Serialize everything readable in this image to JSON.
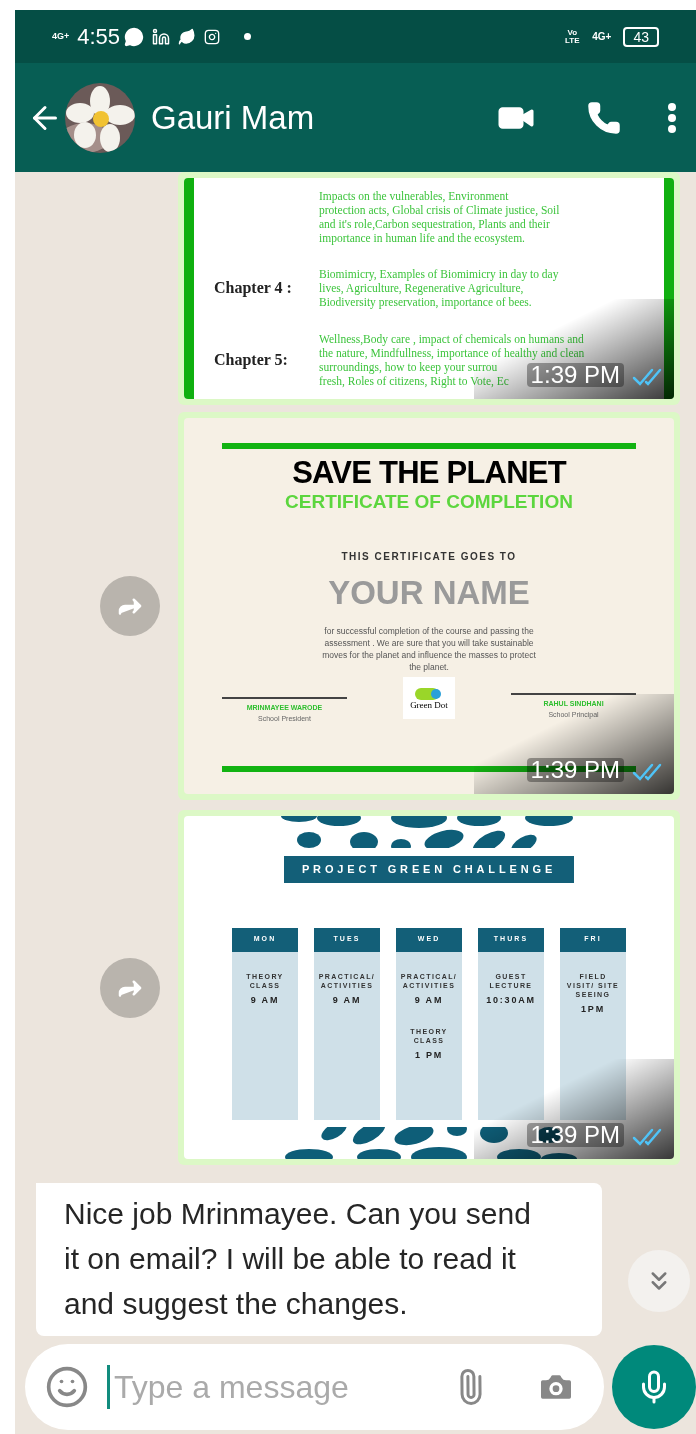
{
  "status_bar": {
    "network": "4G+",
    "time": "4:55",
    "volte": "Vo LTE",
    "network_right": "4G+",
    "battery": "43"
  },
  "header": {
    "contact_name": "Gauri Mam"
  },
  "messages": [
    {
      "kind": "syllabus",
      "forward_button": false,
      "time": "1:39 PM",
      "read": true,
      "rows": [
        {
          "lines": [
            "Impacts on the vulnerables, Environment",
            "protection acts, Global crisis of Climate justice, Soil",
            "and it's role,Carbon sequestration, Plants and their",
            "importance in human life and the ecosystem."
          ]
        },
        {
          "label": "Chapter 4 :",
          "lines": [
            "Biomimicry, Examples of Biomimicry in day to day",
            "lives, Agriculture, Regenerative Agriculture,",
            "Biodiversity preservation, importance of bees."
          ]
        },
        {
          "label": "Chapter 5:",
          "lines": [
            "Wellness,Body care , impact of chemicals on humans and",
            "the nature,  Mindfullness, importance of healthy and clean",
            "surroundings, how to keep your surrou",
            "fresh, Roles of citizens, Right to Vote, Ec"
          ]
        }
      ]
    },
    {
      "kind": "certificate",
      "forward_button": true,
      "time": "1:39 PM",
      "read": true,
      "title": "SAVE THE PLANET",
      "subtitle": "CERTIFICATE OF COMPLETION",
      "intro": "THIS CERTIFICATE GOES TO",
      "name": "YOUR NAME",
      "body": "for successful completion of the course and passing the assessment . We are sure that you will take sustainable moves for the planet and influence the masses to protect the planet.",
      "logo": "Green Dot",
      "signatories": [
        {
          "name": "MRINMAYEE WARODE",
          "role": "School President"
        },
        {
          "name": "RAHUL SINDHANI",
          "role": "School Principal"
        }
      ]
    },
    {
      "kind": "schedule",
      "forward_button": true,
      "time": "1:39 PM",
      "read": true,
      "title": "PROJECT GREEN CHALLENGE",
      "days": [
        {
          "day": "MON",
          "entries": [
            {
              "activity": "THEORY CLASS",
              "time": "9 AM"
            }
          ]
        },
        {
          "day": "TUES",
          "entries": [
            {
              "activity": "PRACTICAL/ ACTIVITIES",
              "time": "9 AM"
            }
          ]
        },
        {
          "day": "WED",
          "entries": [
            {
              "activity": "PRACTICAL/ ACTIVITIES",
              "time": "9 AM"
            },
            {
              "activity": "THEORY CLASS",
              "time": "1 PM"
            }
          ]
        },
        {
          "day": "THURS",
          "entries": [
            {
              "activity": "GUEST LECTURE",
              "time": "10:30AM"
            }
          ]
        },
        {
          "day": "FRI",
          "entries": [
            {
              "activity": "FIELD VISIT/ SITE SEEING",
              "time": "1PM"
            }
          ]
        }
      ]
    },
    {
      "kind": "text",
      "text": "Nice job Mrinmayee. Can you send it on email? I will be able to read it and suggest the changes."
    }
  ],
  "composer": {
    "placeholder": "Type a message"
  }
}
